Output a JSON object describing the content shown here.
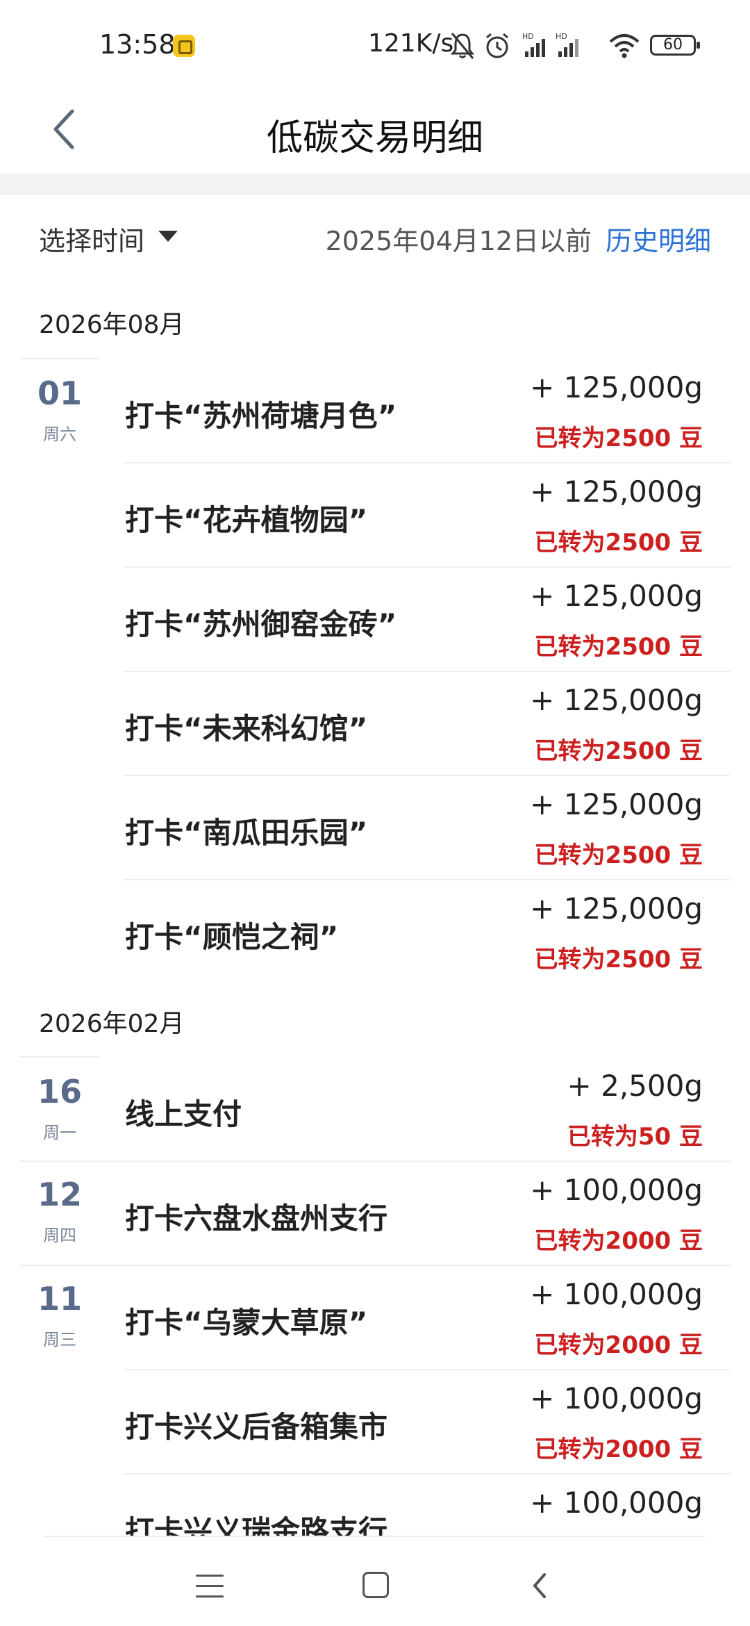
{
  "status_bar": {
    "time": "13:58",
    "network_speed": "121K/s",
    "battery": "60"
  },
  "header": {
    "title": "低碳交易明细"
  },
  "filter": {
    "select_label": "选择时间",
    "date_text": "2025年04月12日以前",
    "history_link": "历史明细"
  },
  "months": [
    {
      "label": "2026年08月",
      "rows": [
        {
          "day": "01",
          "weekday": "周六",
          "title": "打卡“苏州荷塘月色”",
          "amount": "+ 125,000g",
          "converted": "已转为2500 豆"
        },
        {
          "day": "",
          "weekday": "",
          "title": "打卡“花卉植物园”",
          "amount": "+ 125,000g",
          "converted": "已转为2500 豆"
        },
        {
          "day": "",
          "weekday": "",
          "title": "打卡“苏州御窑金砖”",
          "amount": "+ 125,000g",
          "converted": "已转为2500 豆"
        },
        {
          "day": "",
          "weekday": "",
          "title": "打卡“未来科幻馆”",
          "amount": "+ 125,000g",
          "converted": "已转为2500 豆"
        },
        {
          "day": "",
          "weekday": "",
          "title": "打卡“南瓜田乐园”",
          "amount": "+ 125,000g",
          "converted": "已转为2500 豆"
        },
        {
          "day": "",
          "weekday": "",
          "title": "打卡“顾恺之祠”",
          "amount": "+ 125,000g",
          "converted": "已转为2500 豆"
        }
      ]
    },
    {
      "label": "2026年02月",
      "rows": [
        {
          "day": "16",
          "weekday": "周一",
          "title": "线上支付",
          "amount": "+ 2,500g",
          "converted": "已转为50 豆"
        },
        {
          "day": "12",
          "weekday": "周四",
          "title": "打卡六盘水盘州支行",
          "amount": "+ 100,000g",
          "converted": "已转为2000 豆"
        },
        {
          "day": "11",
          "weekday": "周三",
          "title": "打卡“乌蒙大草原”",
          "amount": "+ 100,000g",
          "converted": "已转为2000 豆"
        },
        {
          "day": "",
          "weekday": "",
          "title": "打卡兴义后备箱集市",
          "amount": "+ 100,000g",
          "converted": "已转为2000 豆"
        },
        {
          "day": "",
          "weekday": "",
          "title": "打卡兴义瑞金路支行",
          "amount": "+ 100,000g",
          "converted": ""
        }
      ]
    }
  ],
  "icons": {
    "back": "chevron-left-icon",
    "dropdown": "triangle-down-icon",
    "nav_menu": "menu-icon",
    "nav_home": "square-home-icon",
    "nav_back": "chevron-back-icon"
  },
  "colors": {
    "accent": "#2b72d6",
    "converted_red": "#cc1f1f",
    "day_number": "#5a6a8a"
  }
}
